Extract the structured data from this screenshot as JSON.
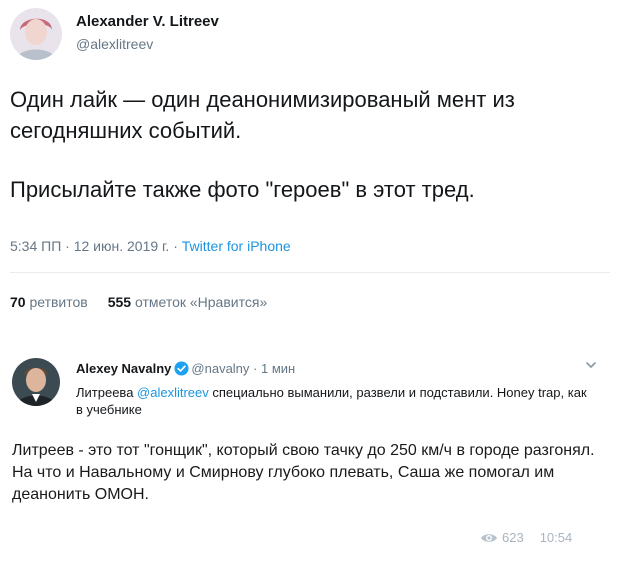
{
  "tweet": {
    "author_name": "Alexander V. Litreev",
    "author_handle": "@alexlitreev",
    "text_line1": "Один лайк — один деанонимизированый мент из сегодняшних событий.",
    "text_line2": "Присылайте также фото \"героев\" в этот тред.",
    "timestamp": "5:34 ПП · 12 июн. 2019 г. · ",
    "source": "Twitter for iPhone",
    "retweets_count": "70",
    "retweets_label": "ретвитов",
    "likes_count": "555",
    "likes_label": "отметок «Нравится»"
  },
  "post": {
    "quoted": {
      "author_name": "Alexey Navalny",
      "author_handle": "@navalny",
      "time": " · 1 мин",
      "text_prefix": "Литреева ",
      "mention": "@alexlitreev",
      "text_rest": " специально выманили, развели и подставили. Honey trap, как в учебнике"
    },
    "body_line1": "Литреев - это тот \"гонщик\", который свою тачку до 250 км/ч в городе разгонял.",
    "body_line2": "На что и Навальному и Смирнову глубоко плевать, Саша же помогал им деанонить ОМОН.",
    "views": "623",
    "time": "10:54"
  },
  "icons": {
    "verified": "verified-badge-icon",
    "chevron": "chevron-down-icon",
    "views": "eye-icon"
  },
  "colors": {
    "link": "#1b95e0",
    "muted": "#657786",
    "text": "#14171a"
  }
}
